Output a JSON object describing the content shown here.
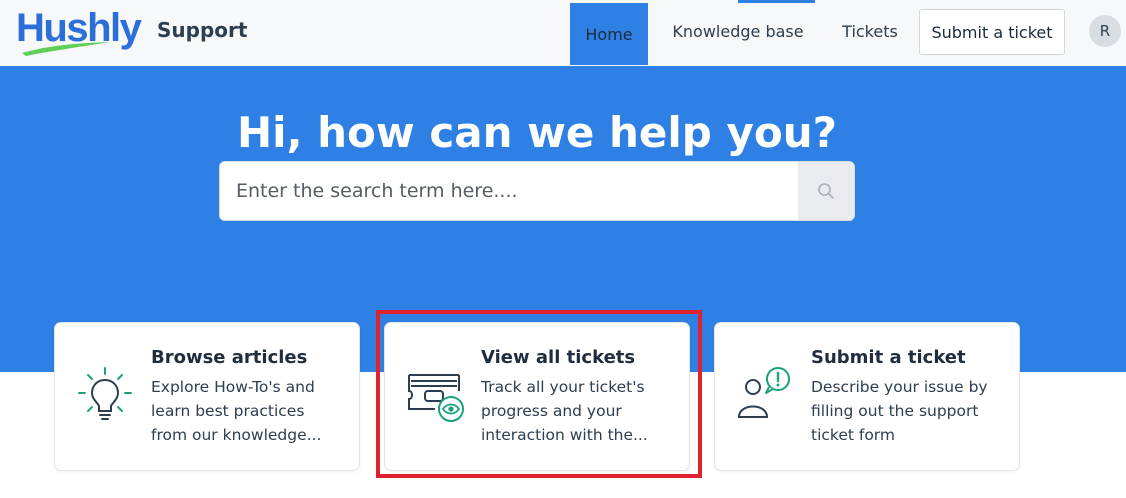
{
  "brand": {
    "logo_text": "Hushly",
    "product": "Support",
    "logo_color": "#2d6fd8",
    "swoosh_color": "#5fcf5a"
  },
  "nav": {
    "home": "Home",
    "knowledge_base": "Knowledge base",
    "tickets": "Tickets",
    "submit_ticket": "Submit a ticket",
    "avatar_initial": "R"
  },
  "hero": {
    "title": "Hi, how can we help you?",
    "search_placeholder": "Enter the search term here....",
    "bg_color": "#2f80e4"
  },
  "cards": [
    {
      "icon": "lightbulb-icon",
      "title": "Browse articles",
      "description": "Explore How-To's and learn best practices from our knowledge..."
    },
    {
      "icon": "ticket-view-icon",
      "title": "View all tickets",
      "description": "Track all your ticket's progress and your interaction with the..."
    },
    {
      "icon": "user-alert-icon",
      "title": "Submit a ticket",
      "description": "Describe your issue by filling out the support ticket form"
    }
  ],
  "accent_green": "#1aa37a",
  "highlight_color": "#e0222e"
}
